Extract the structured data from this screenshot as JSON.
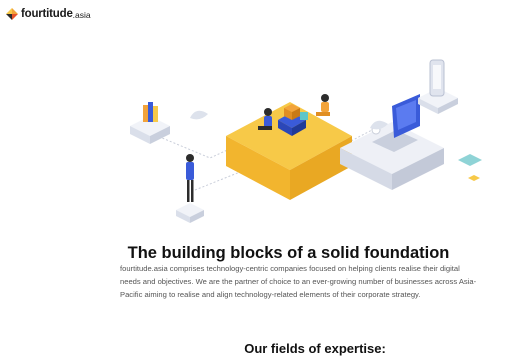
{
  "brand": {
    "name_main": "fourtitude",
    "name_suffix": ".asia"
  },
  "hero": {
    "illustration": "isometric-building-blocks-illustration"
  },
  "intro": {
    "headline": "The building blocks of a solid foundation",
    "paragraph_lines": [
      "fourtitude.asia comprises technology-centric companies focused on helping clients realise their digital",
      "needs and objectives. We are the partner of choice to an ever-growing number of businesses across Asia-",
      "Pacific aiming to realise and align technology-related elements of their corporate strategy."
    ]
  },
  "expertise": {
    "heading": "Our fields of expertise:"
  },
  "colors": {
    "accent_yellow": "#F7C948",
    "accent_orange": "#F2A33A",
    "platform_gray": "#E6E9F2",
    "laptop_blue": "#3A5BD9"
  }
}
